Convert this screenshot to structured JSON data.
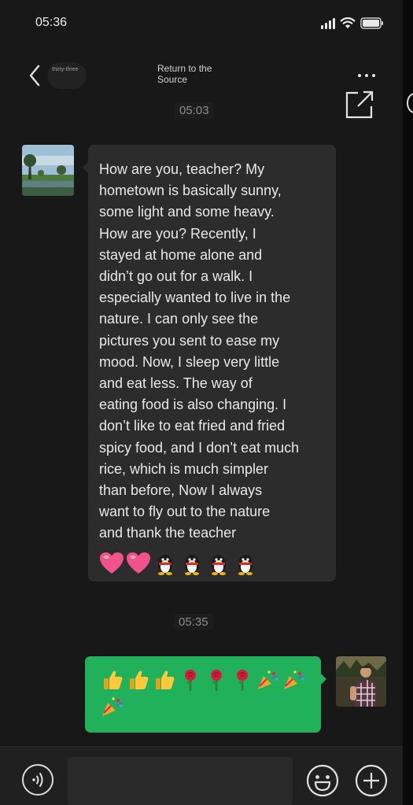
{
  "status_bar": {
    "time": "05:36",
    "icons": [
      "signal-icon",
      "wifi-icon",
      "battery-icon"
    ]
  },
  "nav": {
    "contact_label": "thirty-three",
    "title": "Return to the Source",
    "back_icon": "chevron-left-icon",
    "more_icon": "more-dots-icon",
    "share_icon": "share-icon"
  },
  "messages": [
    {
      "time": "05:03",
      "direction": "incoming",
      "lines": [
        "How are you, teacher? My",
        "hometown is basically sunny,",
        "some light and some heavy.",
        "How are you? Recently, I",
        "stayed at home alone and",
        "didn’t go out for a walk. I",
        "especially wanted to live in the",
        "nature. I can only see the",
        "pictures you sent to ease my",
        "mood. Now, I sleep very little",
        "and eat less. The way of",
        "eating food is also changing. I",
        "don’t like to eat fried and fried",
        "spicy food, and I don’t eat much",
        "rice, which is much simpler",
        "than before, Now I always",
        "want to fly out to the nature",
        "and thank the teacher"
      ],
      "emojis": [
        "heart",
        "heart",
        "penguin",
        "penguin",
        "penguin",
        "penguin"
      ]
    },
    {
      "time": "05:35",
      "direction": "outgoing",
      "emojis": [
        "thumbs-up",
        "thumbs-up",
        "thumbs-up",
        "rose",
        "rose",
        "rose",
        "party-popper",
        "party-popper",
        "party-popper"
      ]
    }
  ],
  "input_bar": {
    "placeholder": "",
    "icons": [
      "voice-icon",
      "emoji-face-icon",
      "add-icon"
    ]
  },
  "colors": {
    "background": "#181818",
    "incoming_bubble": "#2c2c2c",
    "outgoing_bubble": "#21b15b",
    "text": "#e8e8e8"
  }
}
